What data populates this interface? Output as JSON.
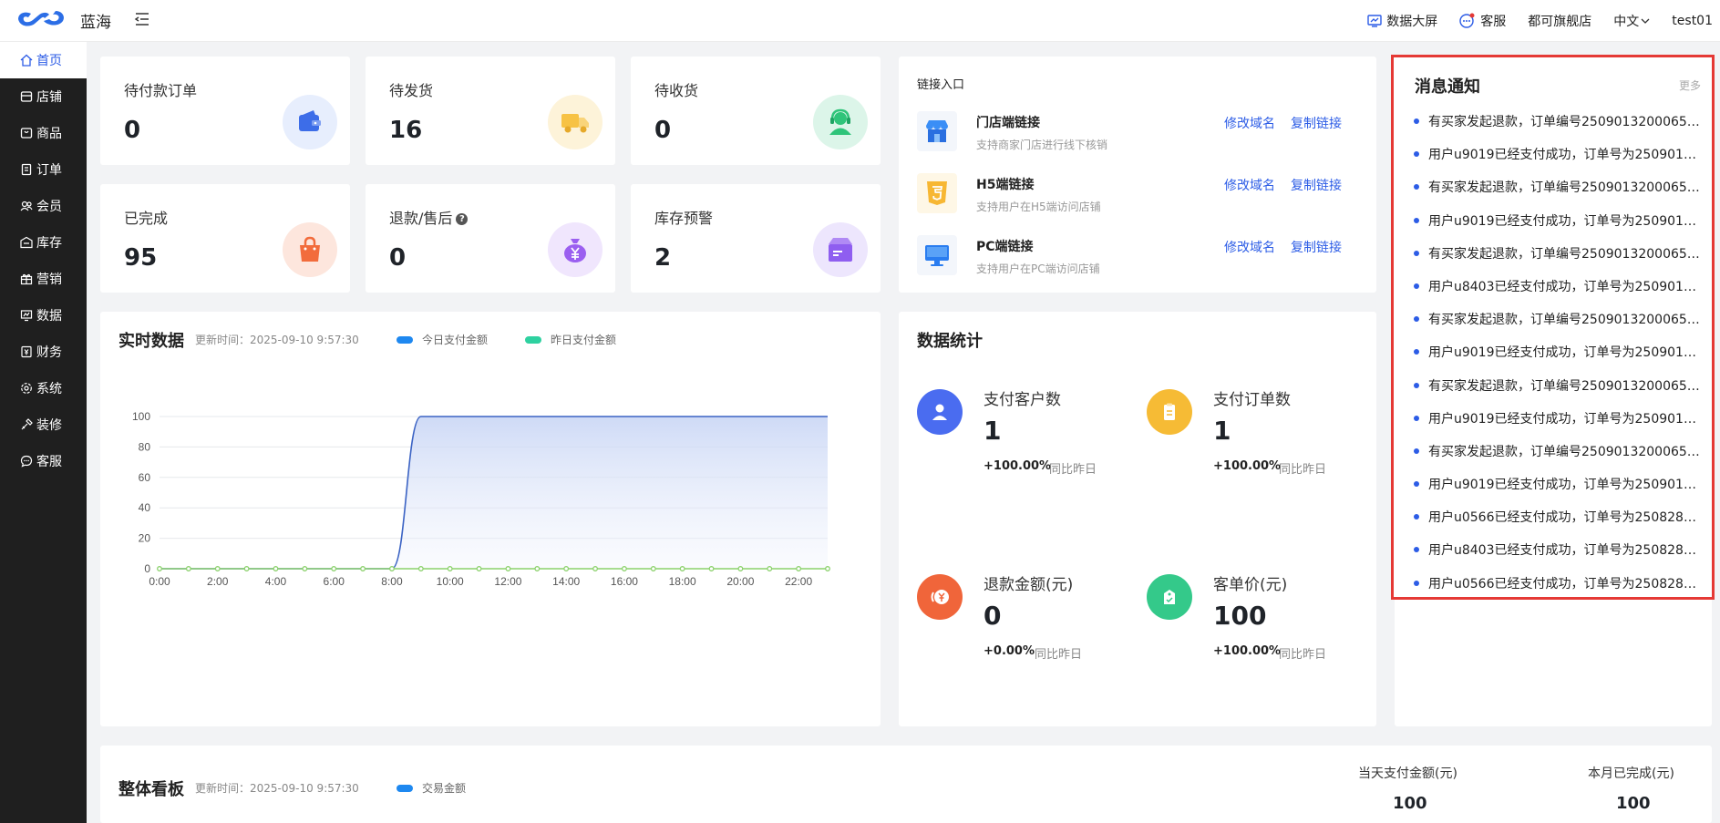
{
  "header": {
    "brand": "蓝海",
    "right": {
      "bigscreen": "数据大屏",
      "service": "客服",
      "store": "都可旗舰店",
      "lang": "中文",
      "user": "test01"
    }
  },
  "sidebar": {
    "items": [
      {
        "label": "首页",
        "icon": "home-icon",
        "active": true
      },
      {
        "label": "店铺",
        "icon": "store-icon"
      },
      {
        "label": "商品",
        "icon": "goods-icon"
      },
      {
        "label": "订单",
        "icon": "order-icon"
      },
      {
        "label": "会员",
        "icon": "member-icon"
      },
      {
        "label": "库存",
        "icon": "stock-icon"
      },
      {
        "label": "营销",
        "icon": "gift-icon"
      },
      {
        "label": "数据",
        "icon": "data-icon"
      },
      {
        "label": "财务",
        "icon": "finance-icon"
      },
      {
        "label": "系统",
        "icon": "settings-icon"
      },
      {
        "label": "装修",
        "icon": "decorate-icon"
      },
      {
        "label": "客服",
        "icon": "chat-icon"
      }
    ]
  },
  "stats": [
    {
      "label": "待付款订单",
      "value": "0",
      "icon": "wallet-icon",
      "color": "#3d6de8",
      "bg": "#e7eefd"
    },
    {
      "label": "待发货",
      "value": "16",
      "icon": "truck-icon",
      "color": "#f7c244",
      "bg": "#fdf3d9"
    },
    {
      "label": "待收货",
      "value": "0",
      "icon": "headset-user-icon",
      "color": "#2fc47a",
      "bg": "#dcf5e9"
    },
    {
      "label": "已完成",
      "value": "95",
      "icon": "shopping-bag-icon",
      "color": "#f26c3c",
      "bg": "#fde6dd"
    },
    {
      "label": "退款/售后",
      "value": "0",
      "icon": "money-bag-icon",
      "color": "#9b5ff0",
      "bg": "#f0e6fd",
      "help": "?"
    },
    {
      "label": "库存预警",
      "value": "2",
      "icon": "box-icon",
      "color": "#8f5ef0",
      "bg": "#ede6fd"
    }
  ],
  "links": {
    "title": "链接入口",
    "items": [
      {
        "name": "门店端链接",
        "desc": "支持商家门店进行线下核销",
        "a1": "修改域名",
        "a2": "复制链接",
        "icon": "shop-icon"
      },
      {
        "name": "H5端链接",
        "desc": "支持用户在H5端访问店铺",
        "a1": "修改域名",
        "a2": "复制链接",
        "icon": "html5-icon"
      },
      {
        "name": "PC端链接",
        "desc": "支持用户在PC端访问店铺",
        "a1": "修改域名",
        "a2": "复制链接",
        "icon": "monitor-icon"
      }
    ]
  },
  "notice": {
    "title": "消息通知",
    "more": "更多",
    "items": [
      "有买家发起退款，订单编号25090132000650...",
      "用户u9019已经支付成功，订单号为2509013...",
      "有买家发起退款，订单编号25090132000650...",
      "用户u9019已经支付成功，订单号为2509013...",
      "有买家发起退款，订单编号25090132000650...",
      "用户u8403已经支付成功，订单号为2509013...",
      "有买家发起退款，订单编号25090132000650...",
      "用户u9019已经支付成功，订单号为2509013...",
      "有买家发起退款，订单编号25090132000650...",
      "用户u9019已经支付成功，订单号为2509013...",
      "有买家发起退款，订单编号25090132000650...",
      "用户u9019已经支付成功，订单号为2509013...",
      "用户u0566已经支付成功，订单号为2508283...",
      "用户u8403已经支付成功，订单号为2508283...",
      "用户u0566已经支付成功，订单号为2508283..."
    ]
  },
  "realtime": {
    "title": "实时数据",
    "updated": "更新时间：2025-09-10  9:57:30"
  },
  "chart_data": {
    "type": "line",
    "title": "实时数据",
    "x": [
      "0:00",
      "1:00",
      "2:00",
      "3:00",
      "4:00",
      "5:00",
      "6:00",
      "7:00",
      "8:00",
      "9:00",
      "10:00",
      "11:00",
      "12:00",
      "13:00",
      "14:00",
      "15:00",
      "16:00",
      "17:00",
      "18:00",
      "19:00",
      "20:00",
      "21:00",
      "22:00",
      "23:00"
    ],
    "xticks": [
      "0:00",
      "2:00",
      "4:00",
      "6:00",
      "8:00",
      "10:00",
      "12:00",
      "14:00",
      "16:00",
      "18:00",
      "20:00",
      "22:00"
    ],
    "series": [
      {
        "name": "今日支付金额",
        "color": "#3b63c4",
        "values": [
          0,
          0,
          0,
          0,
          0,
          0,
          0,
          0,
          0,
          100,
          100,
          100,
          100,
          100,
          100,
          100,
          100,
          100,
          100,
          100,
          100,
          100,
          100,
          100
        ]
      },
      {
        "name": "昨日支付金额",
        "color": "#8bd16c",
        "values": [
          0,
          0,
          0,
          0,
          0,
          0,
          0,
          0,
          0,
          0,
          0,
          0,
          0,
          0,
          0,
          0,
          0,
          0,
          0,
          0,
          0,
          0,
          0,
          0
        ]
      }
    ],
    "legend_colors": [
      "#1e88f0",
      "#2ed1a0"
    ],
    "ylim": [
      0,
      100
    ],
    "yticks": [
      0,
      20,
      40,
      60,
      80,
      100
    ],
    "grid": true,
    "legend": "top"
  },
  "datastats": {
    "title": "数据统计",
    "items": [
      {
        "label": "支付客户数",
        "value": "1",
        "pct": "+100.00%",
        "cmp": "同比昨日",
        "icon": "user-icon",
        "color": "#4a6cf0"
      },
      {
        "label": "支付订单数",
        "value": "1",
        "pct": "+100.00%",
        "cmp": "同比昨日",
        "icon": "clipboard-icon",
        "color": "#f6bb35"
      },
      {
        "label": "退款金额(元)",
        "value": "0",
        "pct": "+0.00%",
        "cmp": "同比昨日",
        "icon": "refund-icon",
        "color": "#f0653a"
      },
      {
        "label": "客单价(元)",
        "value": "100",
        "pct": "+100.00%",
        "cmp": "同比昨日",
        "icon": "tag-icon",
        "color": "#34c98a"
      }
    ]
  },
  "board": {
    "title": "整体看板",
    "updated": "更新时间：2025-09-10  9:57:30",
    "legend": "交易金额",
    "legend_color": "#1e88f0",
    "kpis": [
      {
        "label": "当天支付金额(元)",
        "value": "100"
      },
      {
        "label": "本月已完成(元)",
        "value": "100"
      }
    ]
  }
}
